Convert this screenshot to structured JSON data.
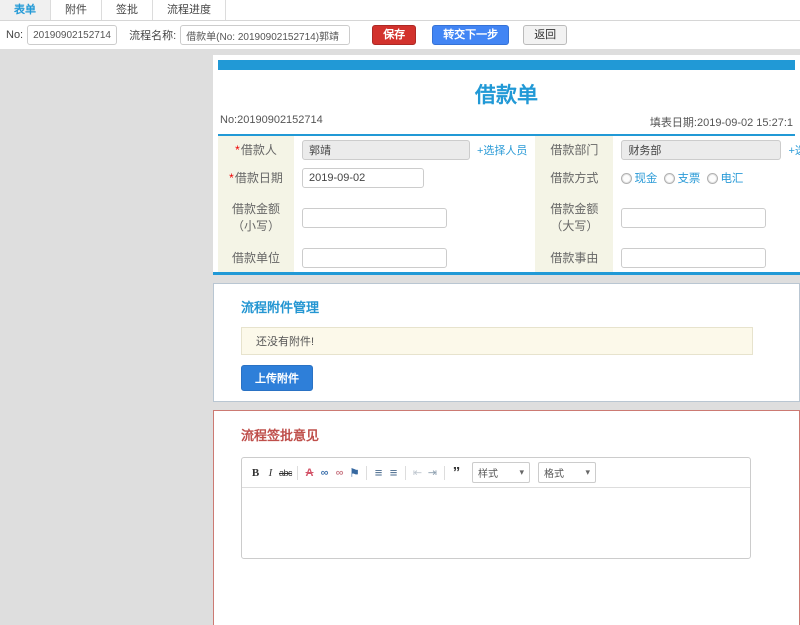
{
  "colors": {
    "accent_blue": "#2199d6",
    "heading_red": "#bf4f4b",
    "save_red": "#d2322d",
    "next_blue": "#4285f4",
    "upload_blue": "#2e7fd9",
    "label_beige": "#f4f4e6",
    "alert_cream": "#fcf9ea",
    "attach_border": "#b9c6d2",
    "sign_border": "#cc7a73"
  },
  "tabs": [
    "表单",
    "附件",
    "签批",
    "流程进度"
  ],
  "toolbar": {
    "no_label": "No:",
    "no_value": "20190902152714",
    "flow_label": "流程名称:",
    "flow_value": "借款单(No: 20190902152714)郭靖",
    "save_label": "保存",
    "next_label": "转交下一步",
    "back_label": "返回"
  },
  "form": {
    "title": "借款单",
    "no_text": "No:20190902152714",
    "date_text": "填表日期:2019-09-02 15:27:1",
    "required_mark": "*",
    "fields": {
      "borrower_label": "借款人",
      "borrower_value": "郭靖",
      "borrower_link": "+选择人员",
      "dept_label": "借款部门",
      "dept_value": "财务部",
      "dept_link": "+选择部门",
      "date_label": "借款日期",
      "date_value": "2019-09-02",
      "method_label": "借款方式",
      "methods": [
        "现金",
        "支票",
        "电汇"
      ],
      "amount_small_label": "借款金额（小写）",
      "amount_big_label": "借款金额（大写）",
      "unit_label": "借款单位",
      "reason_label": "借款事由"
    }
  },
  "attachments": {
    "heading": "流程附件管理",
    "empty_text": "还没有附件!",
    "upload_label": "上传附件"
  },
  "signoff": {
    "heading": "流程签批意见",
    "editor": {
      "bold": "B",
      "italic": "I",
      "strike": "abc",
      "removeformat": "A",
      "link": "∞",
      "unlink": "∞",
      "flag": "⚑",
      "ordered_list": "≡",
      "bullet_list": "≡",
      "outdent": "⇤",
      "indent": "⇥",
      "quote": "”",
      "style_dropdown": "样式",
      "format_dropdown": "格式",
      "caret": "▾"
    }
  }
}
